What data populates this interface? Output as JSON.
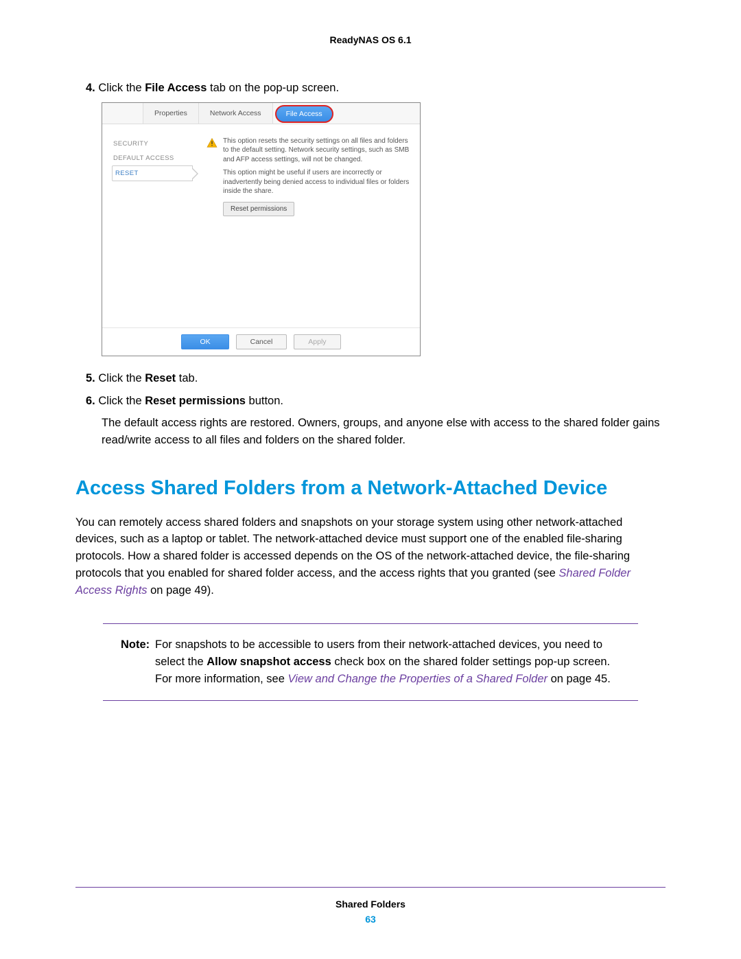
{
  "header": {
    "product": "ReadyNAS OS 6.1"
  },
  "steps": {
    "s4": {
      "num": "4.",
      "pre": "Click the ",
      "bold": "File Access",
      "post": " tab on the pop-up screen."
    },
    "s5": {
      "num": "5.",
      "pre": "Click the ",
      "bold": "Reset",
      "post": " tab."
    },
    "s6": {
      "num": "6.",
      "pre": "Click the ",
      "bold": "Reset permissions",
      "post": " button."
    },
    "s6_body": "The default access rights are restored. Owners, groups, and anyone else with access to the shared folder gains read/write access to all files and folders on the shared folder."
  },
  "screenshot": {
    "tabs": {
      "properties": "Properties",
      "network": "Network Access",
      "file": "File Access"
    },
    "side": {
      "security": "SECURITY",
      "default": "DEFAULT ACCESS",
      "reset": "RESET"
    },
    "warn1": "This option resets the security settings on all files and folders to the default setting. Network security settings, such as SMB and AFP access settings, will not be changed.",
    "warn2": "This option might be useful if users are incorrectly or inadvertently being denied access to individual files or folders inside the share.",
    "reset_btn": "Reset permissions",
    "ok": "OK",
    "cancel": "Cancel",
    "apply": "Apply"
  },
  "section": {
    "heading": "Access Shared Folders from a Network-Attached Device",
    "intro_pre": "You can remotely access shared folders and snapshots on your storage system using other network-attached devices, such as a laptop or tablet. The network-attached device must support one of the enabled file-sharing protocols. How a shared folder is accessed depends on the OS of the network-attached device, the file-sharing protocols that you enabled for shared folder access, and the access rights that you granted (see ",
    "intro_link": "Shared Folder Access Rights",
    "intro_post": " on page 49)."
  },
  "note": {
    "label": "Note:",
    "line1_pre": "For snapshots to be accessible to users from their network-attached devices, you need to select the ",
    "line1_bold": "Allow snapshot access",
    "line1_post": " check box on the shared folder settings pop-up screen. For more information, see ",
    "link": "View and Change the Properties of a Shared Folder",
    "line_end": " on page 45."
  },
  "footer": {
    "chapter": "Shared Folders",
    "page": "63"
  }
}
